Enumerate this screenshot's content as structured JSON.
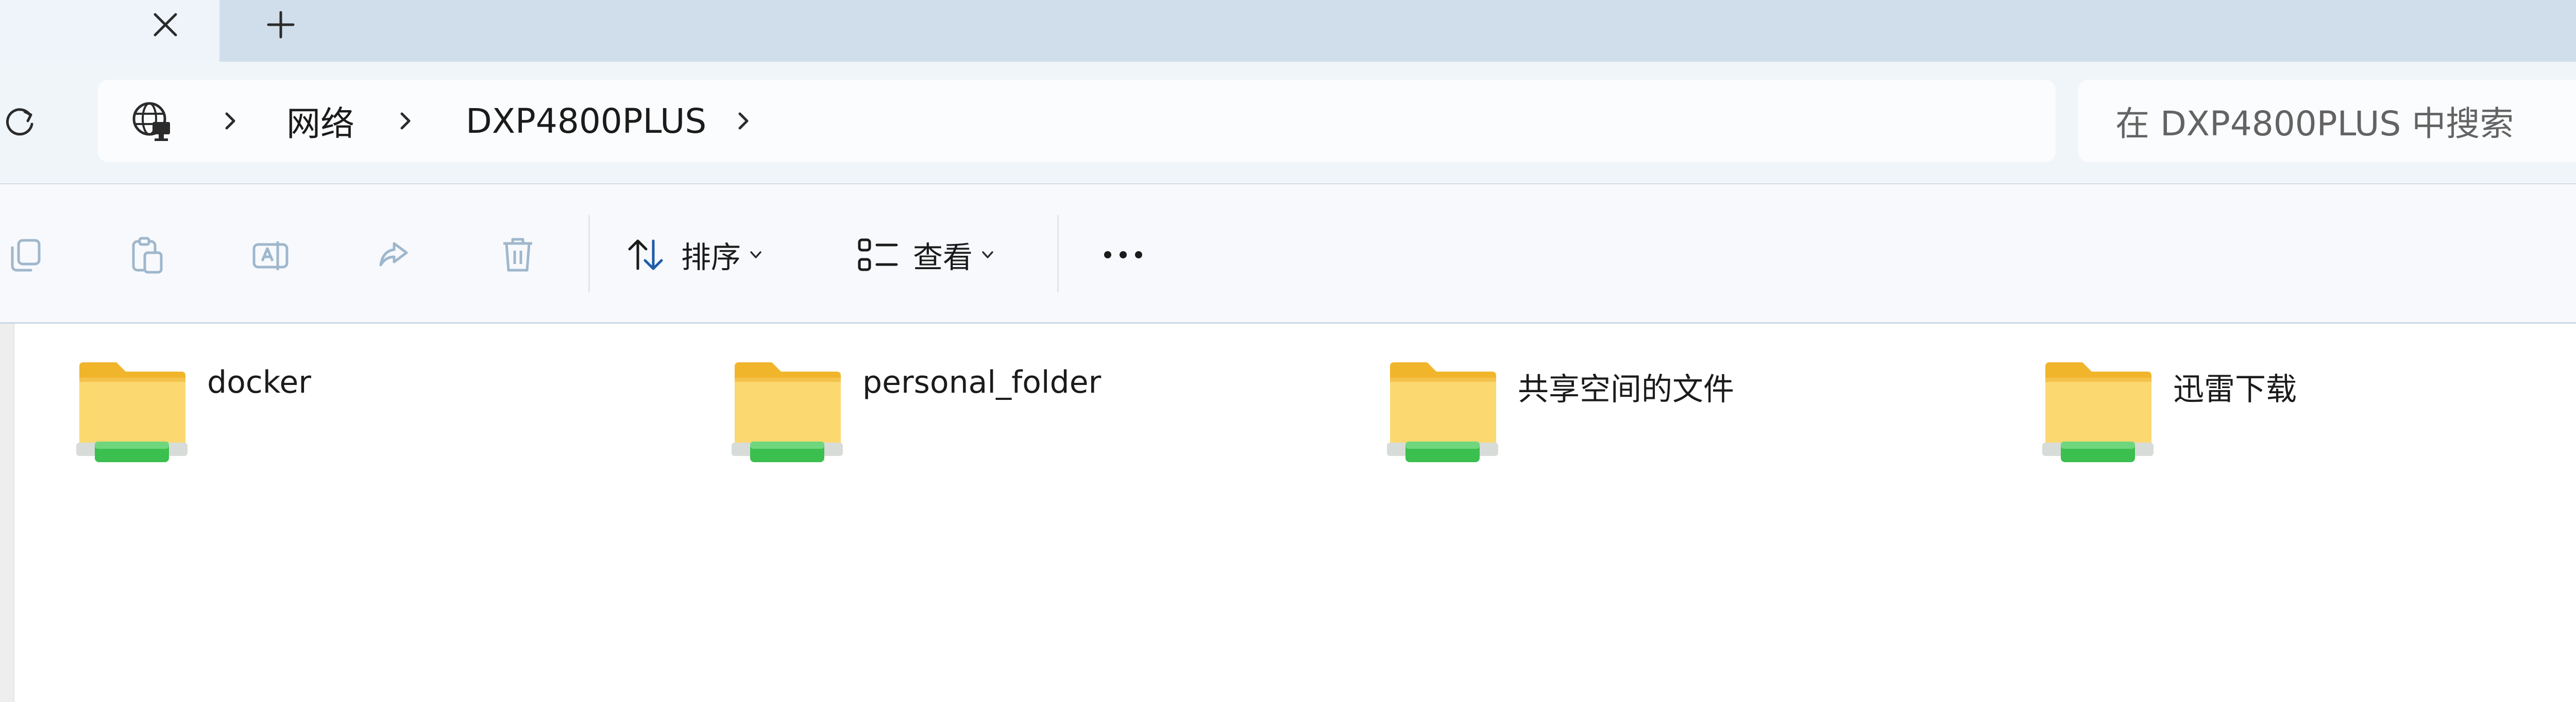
{
  "window": {
    "new_tab_symbol": "+",
    "close_symbol": "×"
  },
  "address": {
    "breadcrumb": [
      "网络",
      "DXP4800PLUS"
    ],
    "search_placeholder": "在 DXP4800PLUS 中搜索"
  },
  "toolbar": {
    "sort_label": "排序",
    "view_label": "查看",
    "more_label": "···"
  },
  "folders": [
    {
      "name": "docker"
    },
    {
      "name": "personal_folder"
    },
    {
      "name": "共享空间的文件"
    },
    {
      "name": "迅雷下载"
    }
  ],
  "colors": {
    "folder_body": "#fcd870",
    "folder_tab": "#f1b52c",
    "share_bar": "#3bbf4f",
    "accent": "#1f5da8"
  }
}
